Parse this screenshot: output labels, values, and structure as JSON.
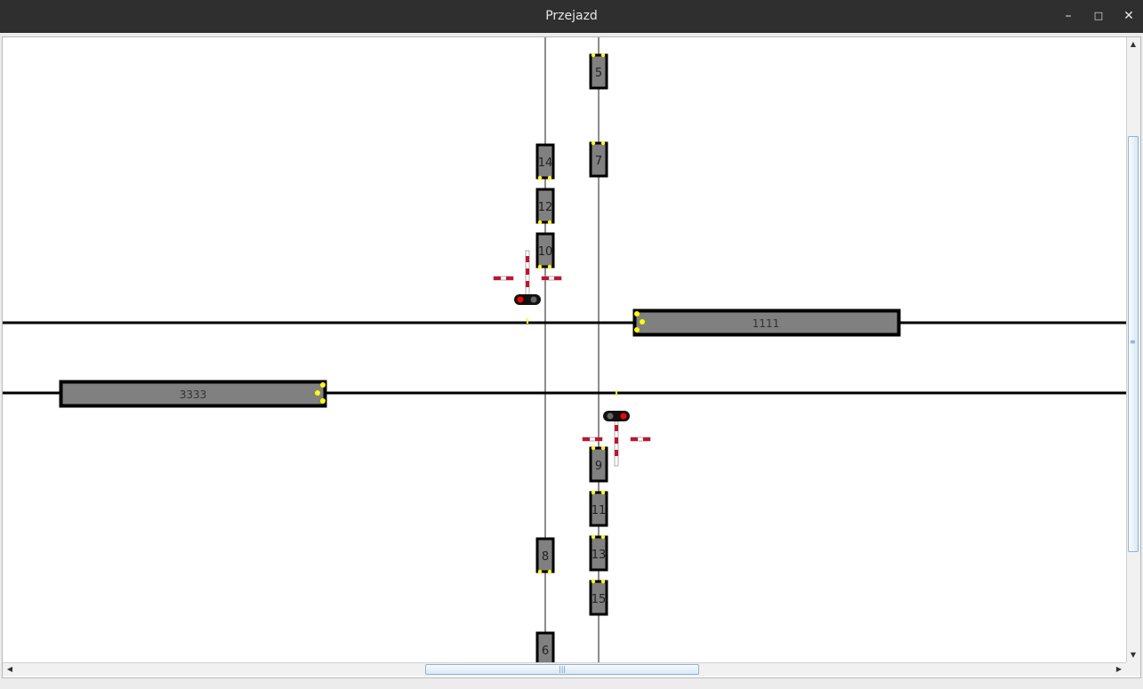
{
  "window": {
    "title": "Przejazd"
  },
  "roads": {
    "left": {
      "cars": [
        {
          "label": "14"
        },
        {
          "label": "12"
        },
        {
          "label": "10"
        },
        {
          "label": "8"
        },
        {
          "label": "6"
        }
      ]
    },
    "right": {
      "cars": [
        {
          "label": "5"
        },
        {
          "label": "7"
        },
        {
          "label": "9"
        },
        {
          "label": "11"
        },
        {
          "label": "13"
        },
        {
          "label": "15"
        }
      ]
    }
  },
  "trains": [
    {
      "label": "1111"
    },
    {
      "label": "3333"
    }
  ],
  "colors": {
    "car_fill": "#808080",
    "light_yellow": "#ffff00",
    "signal_red": "#ff0000",
    "barrier_red": "#c8102e"
  }
}
